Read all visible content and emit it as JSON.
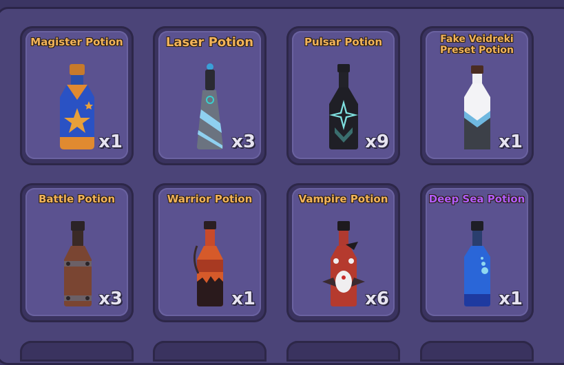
{
  "inventory": {
    "items": [
      {
        "name": "Magister Potion",
        "qty": "x1"
      },
      {
        "name": "Laser Potion",
        "qty": "x3"
      },
      {
        "name": "Pulsar Potion",
        "qty": "x9"
      },
      {
        "name": "Fake Veidreki\nPreset Potion",
        "qty": "x1"
      },
      {
        "name": "Battle Potion",
        "qty": "x3"
      },
      {
        "name": "Warrior Potion",
        "qty": "x1"
      },
      {
        "name": "Vampire Potion",
        "qty": "x6"
      },
      {
        "name": "Deep Sea Potion",
        "qty": "x1"
      }
    ]
  },
  "colors": {
    "name_default": "#f3b45a",
    "name_rare": "#b35cff",
    "panel_bg": "#4b4478",
    "card_bg": "#5b5290"
  }
}
